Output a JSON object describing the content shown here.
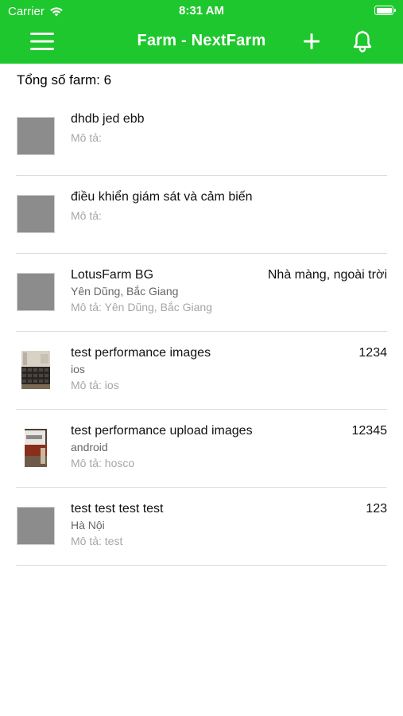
{
  "status_bar": {
    "carrier": "Carrier",
    "time": "8:31 AM"
  },
  "nav": {
    "title": "Farm - NextFarm",
    "menu_icon": "hamburger-menu-icon",
    "add_icon": "plus-icon",
    "bell_icon": "bell-icon"
  },
  "summary": {
    "text": "Tổng số farm: 6"
  },
  "farms": [
    {
      "name": "dhdb jed ebb",
      "location": "",
      "description": "Mô tả:",
      "extra": "",
      "thumbnail": "placeholder"
    },
    {
      "name": "điều khiển giám sát và cảm biến",
      "location": "",
      "description": "Mô tả:",
      "extra": "",
      "thumbnail": "placeholder"
    },
    {
      "name": "LotusFarm BG",
      "location": "Yên Dũng, Bắc Giang",
      "description": "Mô tả: Yên Dũng, Bắc Giang",
      "extra": "Nhà màng, ngoài trời",
      "thumbnail": "placeholder"
    },
    {
      "name": "test performance images",
      "location": "ios",
      "description": "Mô tả: ios",
      "extra": "1234",
      "thumbnail": "photo-seedling-trays"
    },
    {
      "name": "test performance upload images",
      "location": "android",
      "description": "Mô tả: hosco",
      "extra": "12345",
      "thumbnail": "photo-sign"
    },
    {
      "name": "test test test test",
      "location": "Hà Nội",
      "description": "Mô tả: test",
      "extra": "123",
      "thumbnail": "placeholder"
    }
  ],
  "colors": {
    "header_green": "#1ec72d",
    "divider": "#dcdcdc",
    "placeholder_thumb": "#8c8c8c"
  }
}
